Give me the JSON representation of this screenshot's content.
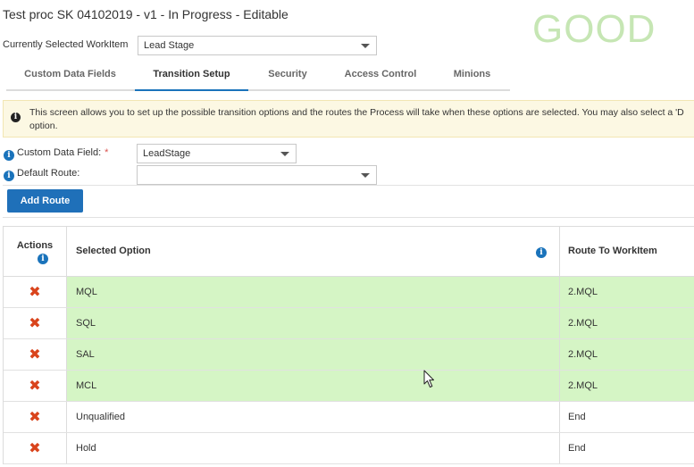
{
  "page": {
    "title": "Test proc SK 04102019 - v1 - In Progress - Editable",
    "stamp": "GOOD"
  },
  "workitem": {
    "label": "Currently Selected WorkItem",
    "selected": "Lead Stage"
  },
  "tabs": [
    {
      "label": "Custom Data Fields",
      "active": false
    },
    {
      "label": "Transition Setup",
      "active": true
    },
    {
      "label": "Security",
      "active": false
    },
    {
      "label": "Access Control",
      "active": false
    },
    {
      "label": "Minions",
      "active": false
    }
  ],
  "info": {
    "line1": "This screen allows you to set up the possible transition options and the routes the Process will take when these options are selected. You may also select a 'D",
    "line2": "option."
  },
  "form": {
    "custom_field_label": "Custom Data Field:",
    "required_mark": "*",
    "custom_field_value": "LeadStage",
    "default_route_label": "Default Route:",
    "default_route_value": ""
  },
  "buttons": {
    "add_route": "Add Route"
  },
  "table": {
    "headers": {
      "actions": "Actions",
      "selected_option": "Selected Option",
      "route_to": "Route To WorkItem"
    },
    "delete_glyph": "✖",
    "rows": [
      {
        "option": "MQL",
        "route": "2.MQL",
        "highlighted": true
      },
      {
        "option": "SQL",
        "route": "2.MQL",
        "highlighted": true
      },
      {
        "option": "SAL",
        "route": "2.MQL",
        "highlighted": true
      },
      {
        "option": "MCL",
        "route": "2.MQL",
        "highlighted": true
      },
      {
        "option": "Unqualified",
        "route": "End",
        "highlighted": false
      },
      {
        "option": "Hold",
        "route": "End",
        "highlighted": false
      }
    ]
  },
  "colors": {
    "accent": "#1f70b9",
    "highlight_row": "#d5f5c5",
    "delete_icon": "#d9441c",
    "info_bg": "#fcf8e3",
    "stamp": "#c6e6b4"
  }
}
